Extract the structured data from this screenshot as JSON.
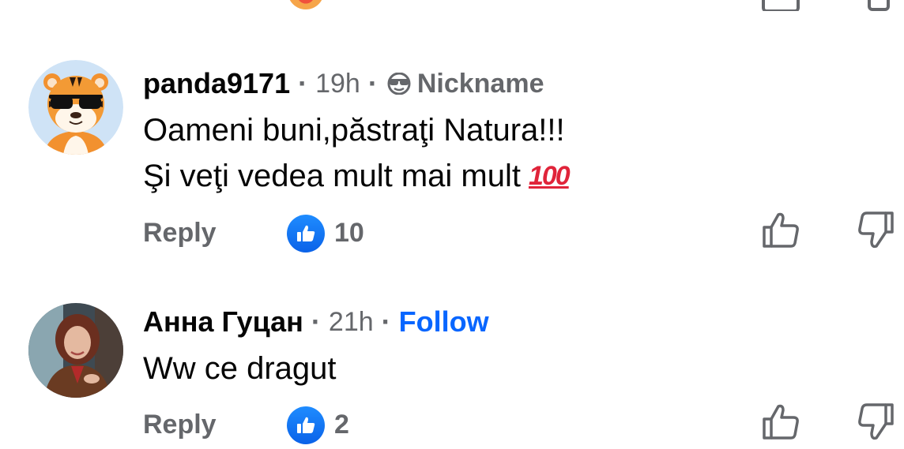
{
  "comments": [
    {
      "author": "panda9171",
      "time": "19h",
      "badge": "Nickname",
      "badge_icon": "sunglasses-face-icon",
      "lines": [
        "Oameni buni,păstraţi Natura!!!",
        "Şi veţi vedea mult mai mult"
      ],
      "emoji": "💯",
      "reply_label": "Reply",
      "like_count": "10",
      "avatar": "tiger-with-sunglasses-avatar"
    },
    {
      "author": "Анна Гуцан",
      "time": "21h",
      "follow_label": "Follow",
      "lines": [
        "Ww ce dragut"
      ],
      "reply_label": "Reply",
      "like_count": "2",
      "avatar": "woman-portrait-avatar"
    }
  ],
  "colors": {
    "muted": "#65676b",
    "text": "#050505",
    "follow": "#0866ff",
    "like_badge": "#1877f2",
    "hundred": "#e0243a"
  },
  "icons": [
    "thumbs-up-outline-icon",
    "thumbs-down-outline-icon",
    "like-badge-icon"
  ]
}
